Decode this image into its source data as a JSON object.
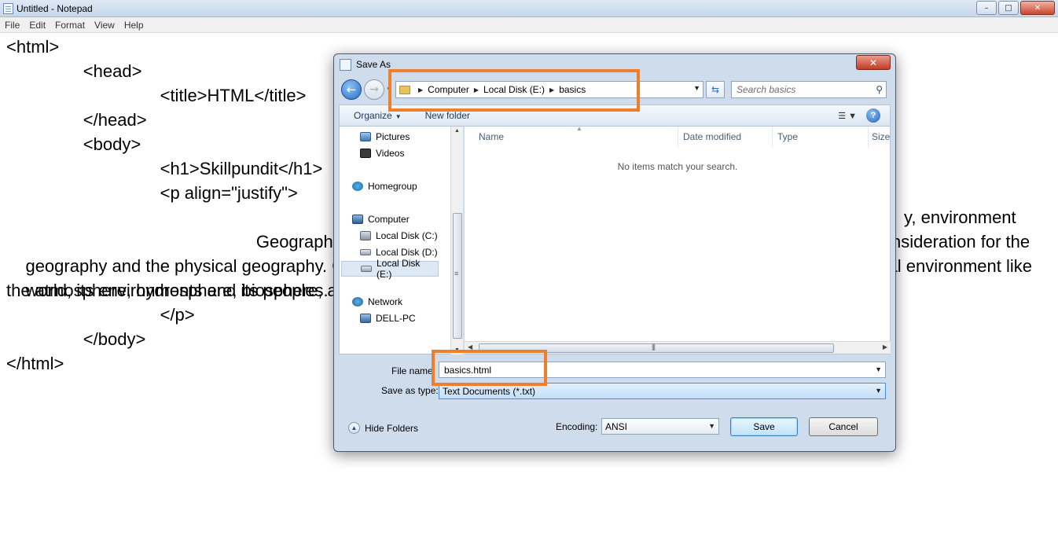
{
  "notepad": {
    "title": "Untitled - Notepad",
    "menu": [
      "File",
      "Edit",
      "Format",
      "View",
      "Help"
    ],
    "lines": [
      "<html>",
      "                <head>",
      "                                <title>HTML</title>",
      "                </head>",
      "                <body>",
      "                                <h1>Skillpundit</h1>",
      "                                <p align=\"justify\">",
      "                                                Geography",
      "y, environment",
      "geography and the physical geography. Ge",
      "nsideration for the",
      "world, its environments and its peoples. Phy",
      "ural environment like",
      "the atmosphere, hydrosphere, biosphere, a",
      "                                </p>",
      "                </body>",
      "</html>"
    ]
  },
  "dialog": {
    "title": "Save As",
    "breadcrumb": [
      "Computer",
      "Local Disk (E:)",
      "basics"
    ],
    "search_placeholder": "Search basics",
    "toolbar": {
      "organize": "Organize",
      "new_folder": "New folder"
    },
    "nav_items": [
      {
        "label": "Pictures",
        "icon": "pictures-icon"
      },
      {
        "label": "Videos",
        "icon": "videos-icon"
      },
      {
        "label": "Homegroup",
        "icon": "homegroup-icon"
      },
      {
        "label": "Computer",
        "icon": "computer-icon"
      },
      {
        "label": "Local Disk (C:)",
        "icon": "disk-icon"
      },
      {
        "label": "Local Disk (D:)",
        "icon": "disk-icon"
      },
      {
        "label": "Local Disk (E:)",
        "icon": "disk-icon",
        "selected": true
      },
      {
        "label": "Network",
        "icon": "network-icon"
      },
      {
        "label": "DELL-PC",
        "icon": "pc-icon"
      }
    ],
    "columns": [
      "Name",
      "Date modified",
      "Type",
      "Size"
    ],
    "empty_message": "No items match your search.",
    "file_name_label": "File name:",
    "file_name_value": "basics.html",
    "save_type_label": "Save as type:",
    "save_type_value": "Text Documents (*.txt)",
    "hide_folders": "Hide Folders",
    "encoding_label": "Encoding:",
    "encoding_value": "ANSI",
    "save_button": "Save",
    "cancel_button": "Cancel"
  },
  "colors": {
    "highlight": "#f07f2d",
    "dialog_frame": "#cfdcec",
    "selected_field": "#c4def7"
  }
}
